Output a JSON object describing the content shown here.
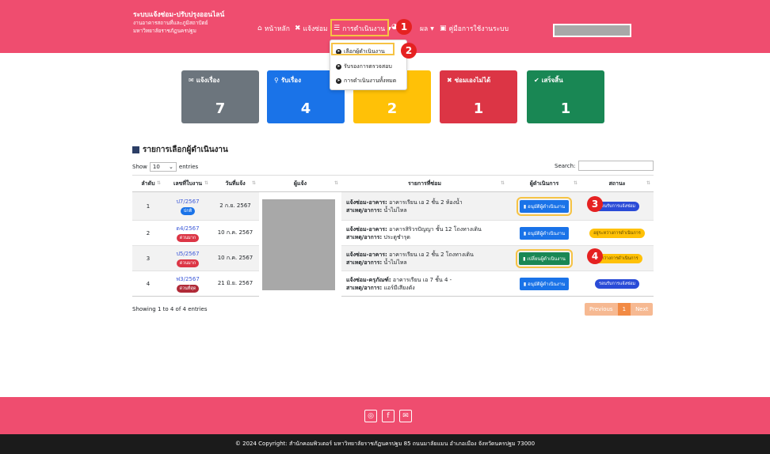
{
  "header": {
    "brand_line1": "ระบบแจ้งซ่อม-ปรับปรุงออนไลน์",
    "brand_line2": "งานอาคารสถานที่และภูมิสถาปัตย์",
    "brand_line3": "มหาวิทยาลัยราชภัฏนครปฐม",
    "nav_home": "หน้าหลัก",
    "nav_report": "แจ้งซ่อม",
    "nav_operation": "การดำเนินงาน",
    "nav_result": "ผล",
    "nav_manual": "คู่มือการใช้งานระบบ"
  },
  "dropdown": {
    "items": [
      "เลือกผู้ดำเนินงาน",
      "รับรองการตรวจสอบ",
      "การดำเนินงานทั้งหมด"
    ]
  },
  "callouts": [
    "1",
    "2",
    "3",
    "4"
  ],
  "cards": [
    {
      "label": "แจ้งเรื่อง",
      "value": "7",
      "color": "#6c757d"
    },
    {
      "label": "รับเรื่อง",
      "value": "4",
      "color": "#1a73e8"
    },
    {
      "label": "",
      "value": "2",
      "color": "#ffc107"
    },
    {
      "label": "ซ่อมเองไม่ได้",
      "value": "1",
      "color": "#dc3545"
    },
    {
      "label": "เสร็จสิ้น",
      "value": "1",
      "color": "#198754"
    }
  ],
  "section_title": "รายการเลือกผู้ดำเนินงาน",
  "table_controls": {
    "show": "Show",
    "entries_value": "10",
    "entries": "entries",
    "search": "Search:"
  },
  "table": {
    "headers": [
      "ลำดับ",
      "เลขที่ใบงาน",
      "วันที่แจ้ง",
      "ผู้แจ้ง",
      "รายการที่ซ่อม",
      "ผู้ดำเนินการ",
      "สถานะ"
    ],
    "rows": [
      {
        "no": "1",
        "job": "ป7/2567",
        "urgency": "ปกติ",
        "urgency_color": "#1a73e8",
        "date": "2 ก.ย. 2567",
        "item_title": "แจ้งซ่อม-อาคาร:",
        "item_desc": "อาคารเรียน เอ 2 ชั้น 2 ห้องน้ำ",
        "cause_label": "สาเหตุ/อาการ:",
        "cause": "น้ำไม่ไหล",
        "action": "อนุมัติผู้ดำเนินงาน",
        "action_color": "#1a73e8",
        "status": "รอนรับการแจ้งซ่อม",
        "status_bg": "#2a4bd7",
        "status_fg": "#ffffff"
      },
      {
        "no": "2",
        "job": "ด4/2567",
        "urgency": "ด่วนมาก",
        "urgency_color": "#dc3545",
        "date": "10 ก.ค. 2567",
        "item_title": "แจ้งซ่อม-อาคาร:",
        "item_desc": "อาคารสิริวรปัญญา ชั้น 12 โถงทางเดิน",
        "cause_label": "สาเหตุ/อาการ:",
        "cause": "ประตูชำรุด",
        "action": "อนุมัติผู้ดำเนินงาน",
        "action_color": "#1a73e8",
        "status": "อยู่ระหว่างการดำเนินการ",
        "status_bg": "#ffc107",
        "status_fg": "#5a4500"
      },
      {
        "no": "3",
        "job": "ป5/2567",
        "urgency": "ด่วนมาก",
        "urgency_color": "#dc3545",
        "date": "10 ก.ค. 2567",
        "item_title": "แจ้งซ่อม-อาคาร:",
        "item_desc": "อาคารเรียน เอ 2 ชั้น 2 โถงทางเดิน",
        "cause_label": "สาเหตุ/อาการ:",
        "cause": "น้ำไม่ไหล",
        "action": "เปลี่ยนผู้ดำเนินงาน",
        "action_color": "#198754",
        "status": "ระหว่างการดำเนินการ",
        "status_bg": "#ffc107",
        "status_fg": "#5a4500"
      },
      {
        "no": "4",
        "job": "ฟ3/2567",
        "urgency": "ด่วนที่สุด",
        "urgency_color": "#b02a37",
        "date": "21 มิ.ย. 2567",
        "item_title": "แจ้งซ่อม-ครุภัณฑ์:",
        "item_desc": "อาคารเรียน เอ 7 ชั้น 4 -",
        "cause_label": "สาเหตุ/อาการ:",
        "cause": "แอร์มีเสียงดัง",
        "action": "อนุมัติผู้ดำเนินงาน",
        "action_color": "#1a73e8",
        "status": "รอนรับการแจ้งซ่อม",
        "status_bg": "#2a4bd7",
        "status_fg": "#ffffff"
      }
    ]
  },
  "footer_info": {
    "showing": "Showing 1 to 4 of 4 entries",
    "prev": "Previous",
    "page": "1",
    "next": "Next"
  },
  "footer": {
    "copyright": "© 2024 Copyright: สำนักคอมพิวเตอร์ มหาวิทยาลัยราชภัฏนครปฐม 85 ถนนมาลัยแมน อำเภอเมือง จังหวัดนครปฐม 73000"
  }
}
